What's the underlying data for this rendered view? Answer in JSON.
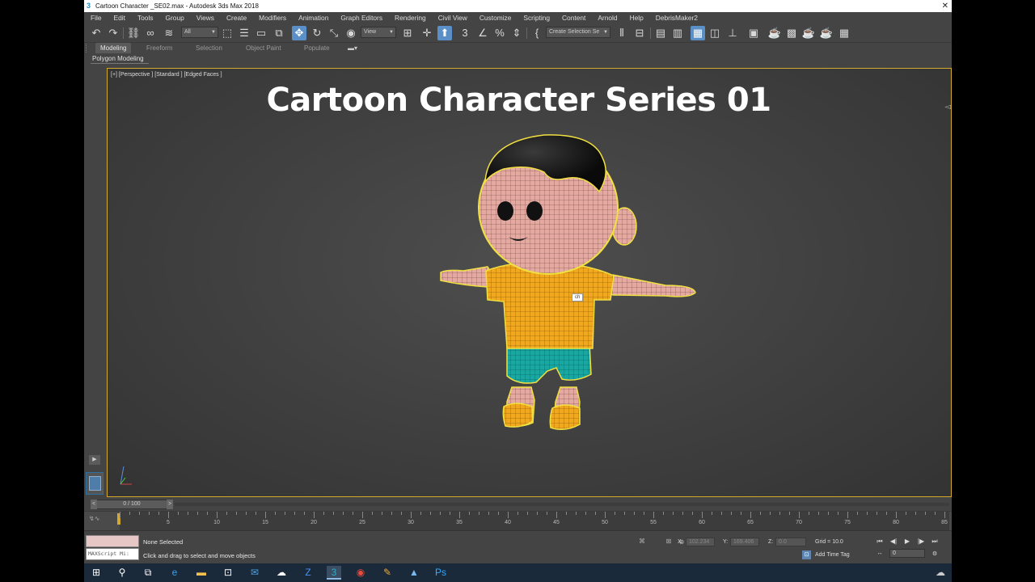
{
  "window": {
    "title": "Cartoon Character _SE02.max - Autodesk 3ds Max 2018",
    "close_glyph": "✕"
  },
  "menu": [
    "File",
    "Edit",
    "Tools",
    "Group",
    "Views",
    "Create",
    "Modifiers",
    "Animation",
    "Graph Editors",
    "Rendering",
    "Civil View",
    "Customize",
    "Scripting",
    "Content",
    "Arnold",
    "Help",
    "DebrisMaker2"
  ],
  "toolbar": {
    "selection_filter": "All",
    "ref_coord": "View",
    "named_selection": "Create Selection Se",
    "icons": [
      "undo-icon",
      "redo-icon",
      "link-icon",
      "unlink-icon",
      "bind-spacewarp-icon",
      "select-object-icon",
      "select-by-name-icon",
      "rect-selection-icon",
      "window-crossing-icon",
      "select-move-icon",
      "select-rotate-icon",
      "select-scale-icon",
      "select-place-icon",
      "pivot-icon",
      "keyboard-shortcut-icon",
      "snaps-toggle-icon",
      "angle-snap-icon",
      "percent-snap-icon",
      "spinner-snap-icon",
      "edit-named-sel-icon",
      "mirror-icon",
      "align-icon",
      "scene-explorer-icon",
      "layer-explorer-icon",
      "ribbon-toggle-icon",
      "curve-editor-icon",
      "schematic-view-icon",
      "material-editor-icon",
      "render-setup-icon",
      "rendered-frame-icon",
      "render-icon",
      "render-iterative-icon",
      "a360-render-icon",
      "teapot-icon",
      "grid-layout-icon"
    ]
  },
  "ribbon": {
    "tabs": [
      "Modeling",
      "Freeform",
      "Selection",
      "Object Paint",
      "Populate"
    ],
    "active_tab": "Modeling",
    "sub_label": "Polygon Modeling"
  },
  "viewport": {
    "label": "[+] [Perspective ] [Standard ] [Edged Faces ]",
    "title": "Cartoon Character Series 01",
    "tooltip": "ch"
  },
  "timeline": {
    "slider_text": "0 / 100",
    "ticks": [
      "5",
      "10",
      "15",
      "20",
      "25",
      "30",
      "35",
      "40",
      "45",
      "50",
      "55",
      "60",
      "65",
      "70",
      "75",
      "80",
      "85"
    ]
  },
  "status": {
    "selection": "None Selected",
    "prompt": "Click and drag to select and move objects",
    "maxscript": "MAXScript Mi:",
    "x_label": "X:",
    "x_value": "102.234",
    "y_label": "Y:",
    "y_value": "169.406",
    "z_label": "Z:",
    "z_value": "0.0",
    "grid": "Grid = 10.0",
    "add_time_tag": "Add Time Tag",
    "frame": "0"
  },
  "colors": {
    "viewport_border": "#d4a82c",
    "accent": "#5b8fc7",
    "shirt": "#f0a820",
    "shorts": "#1aa7a2",
    "skin": "#e4a9a1"
  }
}
